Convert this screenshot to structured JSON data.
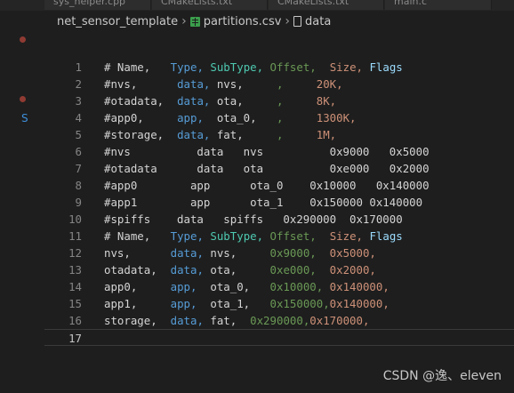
{
  "tabs": [
    {
      "label": "sys_helper.cpp"
    },
    {
      "label": "CMakeLists.txt"
    },
    {
      "label": "CMakeLists.txt"
    },
    {
      "label": "main.c"
    }
  ],
  "breadcrumb": {
    "folder": "net_sensor_template",
    "file": "partitions.csv",
    "symbol": "data"
  },
  "activity": {
    "letter": "S"
  },
  "colors": {
    "background": "#1e1e1e",
    "default_text": "#d4d4d4",
    "blue": "#569cd6",
    "green": "#6a9955",
    "teal": "#4ec9b0",
    "orange": "#ce9178",
    "purple": "#c586c0",
    "light_blue": "#9cdcfe",
    "line_number": "#858585"
  },
  "editor": {
    "lines": [
      {
        "num": "1",
        "segments": [
          {
            "t": "# Name,   ",
            "c": "default_text"
          },
          {
            "t": "Type,",
            "c": "blue"
          },
          {
            "t": " ",
            "c": "default_text"
          },
          {
            "t": "SubType,",
            "c": "teal"
          },
          {
            "t": " ",
            "c": "default_text"
          },
          {
            "t": "Offset,",
            "c": "green"
          },
          {
            "t": "  ",
            "c": "default_text"
          },
          {
            "t": "Size,",
            "c": "orange"
          },
          {
            "t": " ",
            "c": "default_text"
          },
          {
            "t": "Flags",
            "c": "light_blue"
          }
        ]
      },
      {
        "num": "2",
        "segments": [
          {
            "t": "#nvs,      ",
            "c": "default_text"
          },
          {
            "t": "data,",
            "c": "blue"
          },
          {
            "t": " nvs,     ",
            "c": "default_text"
          },
          {
            "t": ",",
            "c": "green"
          },
          {
            "t": "     ",
            "c": "default_text"
          },
          {
            "t": "20K,",
            "c": "orange"
          }
        ]
      },
      {
        "num": "3",
        "segments": [
          {
            "t": "#otadata,  ",
            "c": "default_text"
          },
          {
            "t": "data,",
            "c": "blue"
          },
          {
            "t": " ota,     ",
            "c": "default_text"
          },
          {
            "t": ",",
            "c": "green"
          },
          {
            "t": "     ",
            "c": "default_text"
          },
          {
            "t": "8K,",
            "c": "orange"
          }
        ]
      },
      {
        "num": "4",
        "segments": [
          {
            "t": "#app0,     ",
            "c": "default_text"
          },
          {
            "t": "app,",
            "c": "blue"
          },
          {
            "t": "  ota_0,   ",
            "c": "default_text"
          },
          {
            "t": ",",
            "c": "green"
          },
          {
            "t": "     ",
            "c": "default_text"
          },
          {
            "t": "1300K,",
            "c": "orange"
          }
        ]
      },
      {
        "num": "5",
        "segments": [
          {
            "t": "#storage,  ",
            "c": "default_text"
          },
          {
            "t": "data,",
            "c": "blue"
          },
          {
            "t": " fat,     ",
            "c": "default_text"
          },
          {
            "t": ",",
            "c": "green"
          },
          {
            "t": "     ",
            "c": "default_text"
          },
          {
            "t": "1M,",
            "c": "orange"
          }
        ]
      },
      {
        "num": "6",
        "segments": [
          {
            "t": "#nvs          data   nvs          0x9000   0x5000",
            "c": "default_text"
          }
        ]
      },
      {
        "num": "7",
        "segments": [
          {
            "t": "#otadata      data   ota          0xe000   0x2000",
            "c": "default_text"
          }
        ]
      },
      {
        "num": "8",
        "segments": [
          {
            "t": "#app0        app      ota_0    0x10000   0x140000",
            "c": "default_text"
          }
        ]
      },
      {
        "num": "9",
        "segments": [
          {
            "t": "#app1        app      ota_1    0x150000 0x140000",
            "c": "default_text"
          }
        ]
      },
      {
        "num": "10",
        "segments": [
          {
            "t": "#spiffs    data   spiffs   0x290000  0x170000",
            "c": "default_text"
          }
        ]
      },
      {
        "num": "11",
        "segments": [
          {
            "t": "# Name,   ",
            "c": "default_text"
          },
          {
            "t": "Type,",
            "c": "blue"
          },
          {
            "t": " ",
            "c": "default_text"
          },
          {
            "t": "SubType,",
            "c": "teal"
          },
          {
            "t": " ",
            "c": "default_text"
          },
          {
            "t": "Offset,",
            "c": "green"
          },
          {
            "t": "  ",
            "c": "default_text"
          },
          {
            "t": "Size,",
            "c": "orange"
          },
          {
            "t": " ",
            "c": "default_text"
          },
          {
            "t": "Flags",
            "c": "light_blue"
          }
        ]
      },
      {
        "num": "12",
        "segments": [
          {
            "t": "nvs,      ",
            "c": "default_text"
          },
          {
            "t": "data,",
            "c": "blue"
          },
          {
            "t": " nvs,     ",
            "c": "default_text"
          },
          {
            "t": "0x9000,",
            "c": "green"
          },
          {
            "t": "  ",
            "c": "default_text"
          },
          {
            "t": "0x5000,",
            "c": "orange"
          }
        ]
      },
      {
        "num": "13",
        "segments": [
          {
            "t": "otadata,  ",
            "c": "default_text"
          },
          {
            "t": "data,",
            "c": "blue"
          },
          {
            "t": " ota,     ",
            "c": "default_text"
          },
          {
            "t": "0xe000,",
            "c": "green"
          },
          {
            "t": "  ",
            "c": "default_text"
          },
          {
            "t": "0x2000,",
            "c": "orange"
          }
        ]
      },
      {
        "num": "14",
        "segments": [
          {
            "t": "app0,     ",
            "c": "default_text"
          },
          {
            "t": "app,",
            "c": "blue"
          },
          {
            "t": "  ota_0,   ",
            "c": "default_text"
          },
          {
            "t": "0x10000,",
            "c": "green"
          },
          {
            "t": " ",
            "c": "default_text"
          },
          {
            "t": "0x140000,",
            "c": "orange"
          }
        ]
      },
      {
        "num": "15",
        "segments": [
          {
            "t": "app1,     ",
            "c": "default_text"
          },
          {
            "t": "app,",
            "c": "blue"
          },
          {
            "t": "  ota_1,   ",
            "c": "default_text"
          },
          {
            "t": "0x150000,",
            "c": "green"
          },
          {
            "t": "0x140000,",
            "c": "orange"
          }
        ]
      },
      {
        "num": "16",
        "segments": [
          {
            "t": "storage,  ",
            "c": "default_text"
          },
          {
            "t": "data,",
            "c": "blue"
          },
          {
            "t": " fat,  ",
            "c": "default_text"
          },
          {
            "t": "0x290000,",
            "c": "green"
          },
          {
            "t": "0x170000,",
            "c": "orange"
          }
        ]
      },
      {
        "num": "17",
        "segments": [],
        "current": true
      }
    ]
  },
  "watermark": "CSDN @逸、eleven"
}
